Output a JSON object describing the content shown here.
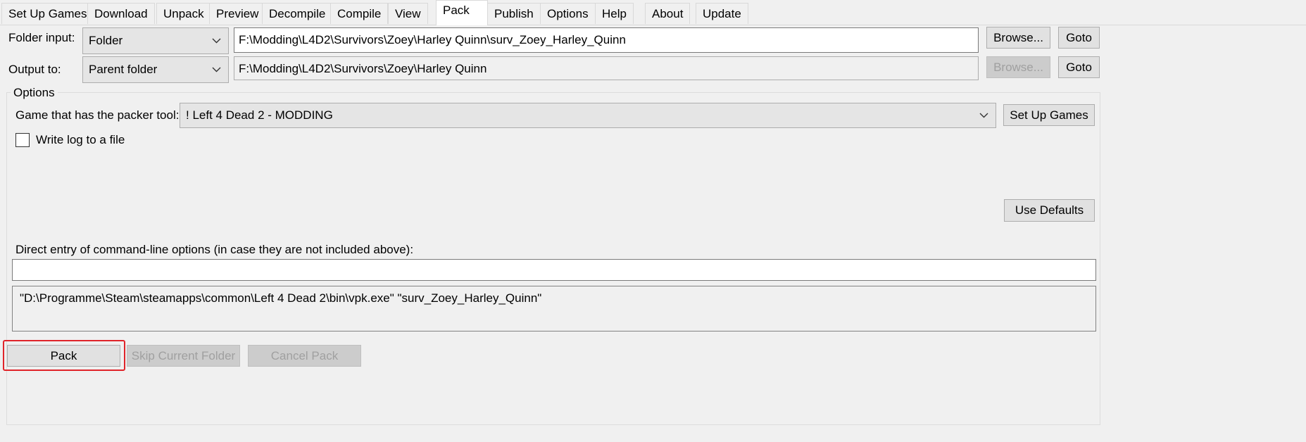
{
  "tabs": [
    {
      "label": "Set Up Games",
      "active": false
    },
    {
      "label": "Download",
      "active": false
    },
    {
      "label": "Unpack",
      "active": false
    },
    {
      "label": "Preview",
      "active": false
    },
    {
      "label": "Decompile",
      "active": false
    },
    {
      "label": "Compile",
      "active": false
    },
    {
      "label": "View",
      "active": false
    },
    {
      "label": "Pack",
      "active": true
    },
    {
      "label": "Publish",
      "active": false
    },
    {
      "label": "Options",
      "active": false
    },
    {
      "label": "Help",
      "active": false
    },
    {
      "label": "About",
      "active": false
    },
    {
      "label": "Update",
      "active": false
    }
  ],
  "folder_input": {
    "label": "Folder input:",
    "mode": "Folder",
    "path": "F:\\Modding\\L4D2\\Survivors\\Zoey\\Harley Quinn\\surv_Zoey_Harley_Quinn",
    "browse": "Browse...",
    "goto": "Goto"
  },
  "output_to": {
    "label": "Output to:",
    "mode": "Parent folder",
    "path": "F:\\Modding\\L4D2\\Survivors\\Zoey\\Harley Quinn",
    "browse": "Browse...",
    "goto": "Goto"
  },
  "options": {
    "title": "Options",
    "game_label": "Game that has the packer tool:",
    "game_value": "! Left 4 Dead 2 - MODDING",
    "setup_games": "Set Up Games",
    "write_log_label": "Write log to a file",
    "write_log_checked": false,
    "use_defaults": "Use Defaults",
    "direct_entry_label": "Direct entry of command-line options (in case they are not included above):",
    "direct_entry_value": "",
    "command_preview": "\"D:\\Programme\\Steam\\steamapps\\common\\Left 4 Dead 2\\bin\\vpk.exe\" \"surv_Zoey_Harley_Quinn\""
  },
  "actions": {
    "pack": "Pack",
    "skip": "Skip Current Folder",
    "cancel": "Cancel Pack"
  },
  "icons": {
    "combo_arrow": "chevron-down-icon"
  }
}
